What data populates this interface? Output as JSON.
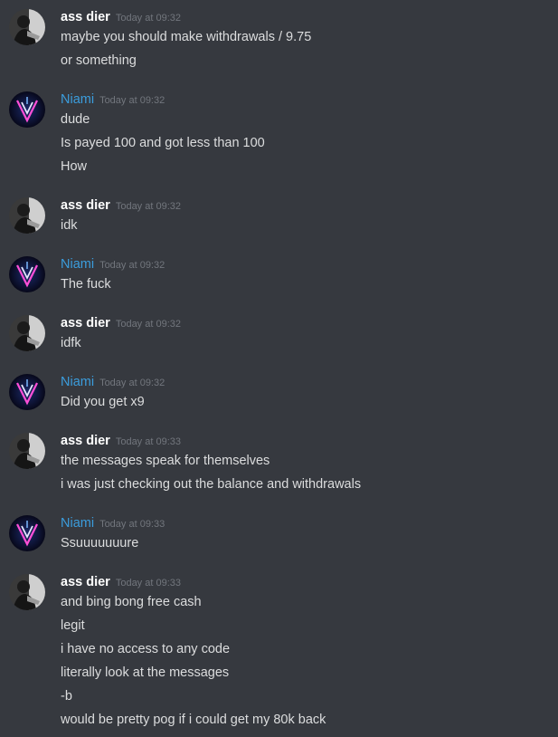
{
  "theme": {
    "background": "#36393f",
    "text": "#dcddde",
    "username_default": "#ffffff",
    "username_niami": "#3b9ddd",
    "timestamp": "#72767d"
  },
  "groups": [
    {
      "author": "ass dier",
      "avatar_icon": "dark-figure-avatar-icon",
      "timestamp": "Today at 09:32",
      "messages": [
        "maybe you should make withdrawals / 9.75",
        "or something"
      ]
    },
    {
      "author": "Niami",
      "avatar_icon": "neon-v-logo-avatar-icon",
      "timestamp": "Today at 09:32",
      "messages": [
        "dude",
        "Is payed 100 and got less than 100",
        "How"
      ]
    },
    {
      "author": "ass dier",
      "avatar_icon": "dark-figure-avatar-icon",
      "timestamp": "Today at 09:32",
      "messages": [
        "idk"
      ]
    },
    {
      "author": "Niami",
      "avatar_icon": "neon-v-logo-avatar-icon",
      "timestamp": "Today at 09:32",
      "messages": [
        "The fuck"
      ]
    },
    {
      "author": "ass dier",
      "avatar_icon": "dark-figure-avatar-icon",
      "timestamp": "Today at 09:32",
      "messages": [
        "idfk"
      ]
    },
    {
      "author": "Niami",
      "avatar_icon": "neon-v-logo-avatar-icon",
      "timestamp": "Today at 09:32",
      "messages": [
        "Did you get x9"
      ]
    },
    {
      "author": "ass dier",
      "avatar_icon": "dark-figure-avatar-icon",
      "timestamp": "Today at 09:33",
      "messages": [
        "the messages speak for themselves",
        "i was just checking out the balance and withdrawals"
      ]
    },
    {
      "author": "Niami",
      "avatar_icon": "neon-v-logo-avatar-icon",
      "timestamp": "Today at 09:33",
      "messages": [
        "Ssuuuuuuure"
      ]
    },
    {
      "author": "ass dier",
      "avatar_icon": "dark-figure-avatar-icon",
      "timestamp": "Today at 09:33",
      "messages": [
        "and bing bong free cash",
        "legit",
        "i have no access to any code",
        "literally look at the messages",
        "-b",
        "would be pretty pog if i could get my 80k back"
      ]
    }
  ]
}
